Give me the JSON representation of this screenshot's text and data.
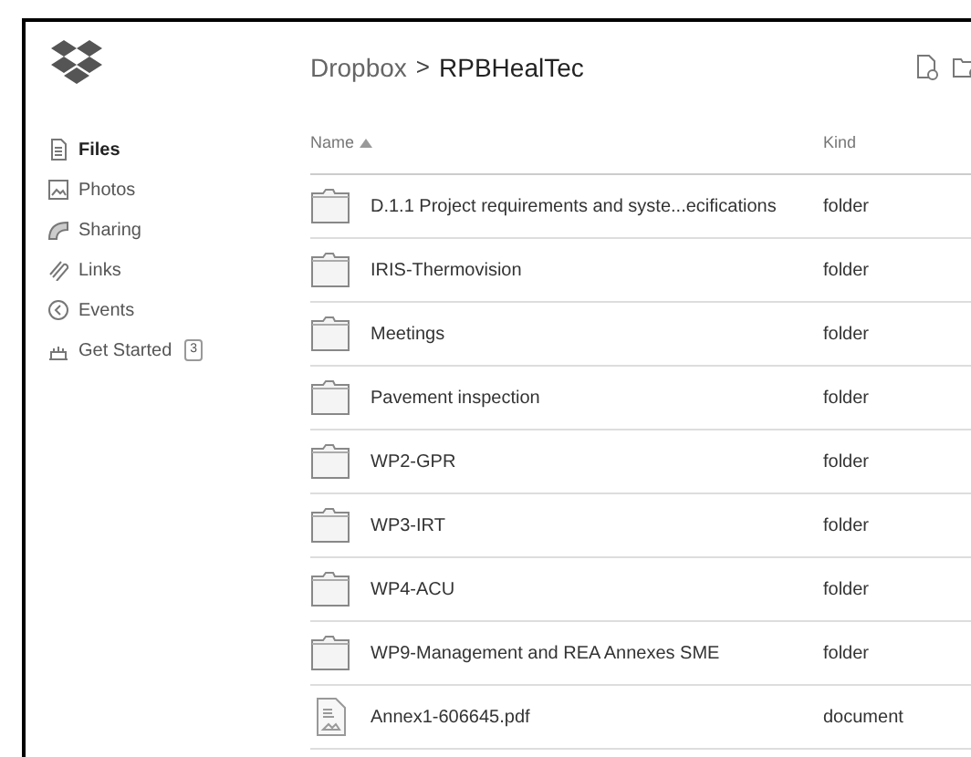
{
  "breadcrumb": {
    "parent": "Dropbox",
    "separator": ">",
    "current": "RPBHealTec"
  },
  "sidebar": {
    "items": [
      {
        "label": "Files",
        "kind": "file",
        "selected": true
      },
      {
        "label": "Photos",
        "kind": "photo",
        "selected": false
      },
      {
        "label": "Sharing",
        "kind": "sharing",
        "selected": false
      },
      {
        "label": "Links",
        "kind": "link",
        "selected": false
      },
      {
        "label": "Events",
        "kind": "events",
        "selected": false
      },
      {
        "label": "Get Started",
        "kind": "cake",
        "selected": false,
        "badge": "3"
      }
    ]
  },
  "table": {
    "columns": [
      {
        "label": "Name",
        "sorted": true
      },
      {
        "label": "Kind",
        "sorted": false
      }
    ],
    "rows": [
      {
        "name": "D.1.1 Project requirements and syste...ecifications",
        "kind": "folder",
        "type": "folder"
      },
      {
        "name": "IRIS-Thermovision",
        "kind": "folder",
        "type": "folder"
      },
      {
        "name": "Meetings",
        "kind": "folder",
        "type": "folder"
      },
      {
        "name": "Pavement inspection",
        "kind": "folder",
        "type": "folder"
      },
      {
        "name": "WP2-GPR",
        "kind": "folder",
        "type": "folder"
      },
      {
        "name": "WP3-IRT",
        "kind": "folder",
        "type": "folder"
      },
      {
        "name": "WP4-ACU",
        "kind": "folder",
        "type": "folder"
      },
      {
        "name": "WP9-Management and REA Annexes SME",
        "kind": "folder",
        "type": "folder"
      },
      {
        "name": "Annex1-606645.pdf",
        "kind": "document",
        "type": "document"
      }
    ]
  }
}
